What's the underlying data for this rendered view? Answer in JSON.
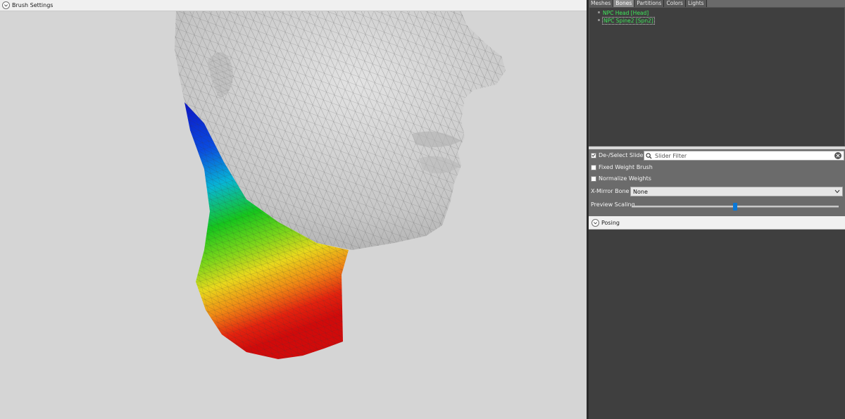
{
  "viewport": {
    "brush_settings_label": "Brush Settings"
  },
  "tabs": [
    {
      "label": "Meshes",
      "active": false
    },
    {
      "label": "Bones",
      "active": true
    },
    {
      "label": "Partitions",
      "active": false
    },
    {
      "label": "Colors",
      "active": false
    },
    {
      "label": "Lights",
      "active": false
    }
  ],
  "bones": [
    {
      "label": "NPC Head [Head]",
      "selected": false
    },
    {
      "label": "NPC Spine2 [Spn2]",
      "selected": true
    }
  ],
  "controls": {
    "deselect_sliders_label": "De-/Select Sliders",
    "deselect_sliders_checked": true,
    "slider_filter_placeholder": "Slider Filter",
    "fixed_weight_label": "Fixed Weight Brush",
    "fixed_weight_checked": false,
    "normalize_weights_label": "Normalize Weights",
    "normalize_weights_checked": false,
    "x_mirror_label": "X-Mirror Bone",
    "x_mirror_value": "None",
    "preview_scaling_label": "Preview Scaling",
    "preview_scaling_value": 0.5
  },
  "posing": {
    "label": "Posing"
  },
  "icons": {
    "search": "search-icon",
    "clear": "clear-icon",
    "dropdown": "chevron-down-icon",
    "collapse": "chevron-down-circle-icon"
  },
  "colors": {
    "bone_text": "#3ee65a",
    "slider_thumb": "#0a78d7",
    "viewport_bg": "#d5d5d5"
  }
}
